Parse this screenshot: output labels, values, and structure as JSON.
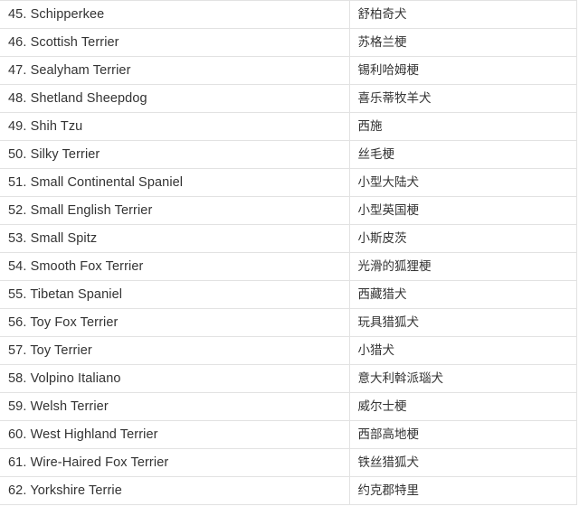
{
  "table": {
    "columns": [
      {
        "key": "name_en",
        "label": ""
      },
      {
        "key": "name_zh",
        "label": ""
      }
    ],
    "rows": [
      {
        "name_en": "45. Schipperkee",
        "name_zh": "舒柏奇犬"
      },
      {
        "name_en": "46. Scottish Terrier",
        "name_zh": "苏格兰梗"
      },
      {
        "name_en": "47. Sealyham Terrier",
        "name_zh": "锡利哈姆梗"
      },
      {
        "name_en": "48. Shetland Sheepdog",
        "name_zh": "喜乐蒂牧羊犬"
      },
      {
        "name_en": "49. Shih Tzu",
        "name_zh": "西施"
      },
      {
        "name_en": "50. Silky Terrier",
        "name_zh": "丝毛梗"
      },
      {
        "name_en": "51. Small Continental Spaniel",
        "name_zh": "小型大陆犬"
      },
      {
        "name_en": "52. Small English Terrier",
        "name_zh": "小型英国梗"
      },
      {
        "name_en": "53. Small Spitz",
        "name_zh": "小斯皮茨"
      },
      {
        "name_en": "54. Smooth Fox Terrier",
        "name_zh": "光滑的狐狸梗"
      },
      {
        "name_en": "55. Tibetan Spaniel",
        "name_zh": "西藏猎犬"
      },
      {
        "name_en": "56. Toy Fox Terrier",
        "name_zh": "玩具猎狐犬"
      },
      {
        "name_en": "57. Toy Terrier",
        "name_zh": "小猎犬"
      },
      {
        "name_en": "58. Volpino Italiano",
        "name_zh": "意大利斡派瑙犬"
      },
      {
        "name_en": "59. Welsh Terrier",
        "name_zh": "威尔士梗"
      },
      {
        "name_en": "60. West Highland Terrier",
        "name_zh": "西部高地梗"
      },
      {
        "name_en": "61. Wire-Haired Fox Terrier",
        "name_zh": "铁丝猎狐犬"
      },
      {
        "name_en": "62. Yorkshire Terrie",
        "name_zh": "约克郡特里"
      }
    ]
  },
  "style": {
    "border_color": "#e2e2e2",
    "text_color": "#333333",
    "background": "#ffffff"
  }
}
